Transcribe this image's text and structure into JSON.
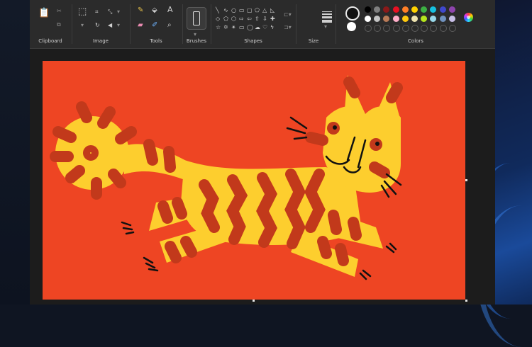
{
  "ribbon": {
    "groups": [
      {
        "id": "clipboard",
        "label": "Clipboard"
      },
      {
        "id": "image",
        "label": "Image"
      },
      {
        "id": "tools",
        "label": "Tools"
      },
      {
        "id": "brushes",
        "label": "Brushes"
      },
      {
        "id": "shapes",
        "label": "Shapes"
      },
      {
        "id": "size",
        "label": "Size"
      },
      {
        "id": "colors",
        "label": "Colors"
      }
    ]
  },
  "colors": {
    "primary": "#111111",
    "secondary": "#ffffff",
    "palette": [
      "#000000",
      "#7f7f7f",
      "#8b1a1a",
      "#e81123",
      "#ff7f27",
      "#ffd200",
      "#3cb043",
      "#16c1e0",
      "#3f48cc",
      "#8e44ad",
      "#ffffff",
      "#c3c3c3",
      "#b97a57",
      "#ffaec9",
      "#ffc90e",
      "#efe4b0",
      "#b5e61d",
      "#99d9ea",
      "#7092be",
      "#c8bfe7"
    ],
    "canvas_bg": "#ee4523",
    "tiger_body": "#fdce2e",
    "tiger_stripes": "#c2391b"
  }
}
